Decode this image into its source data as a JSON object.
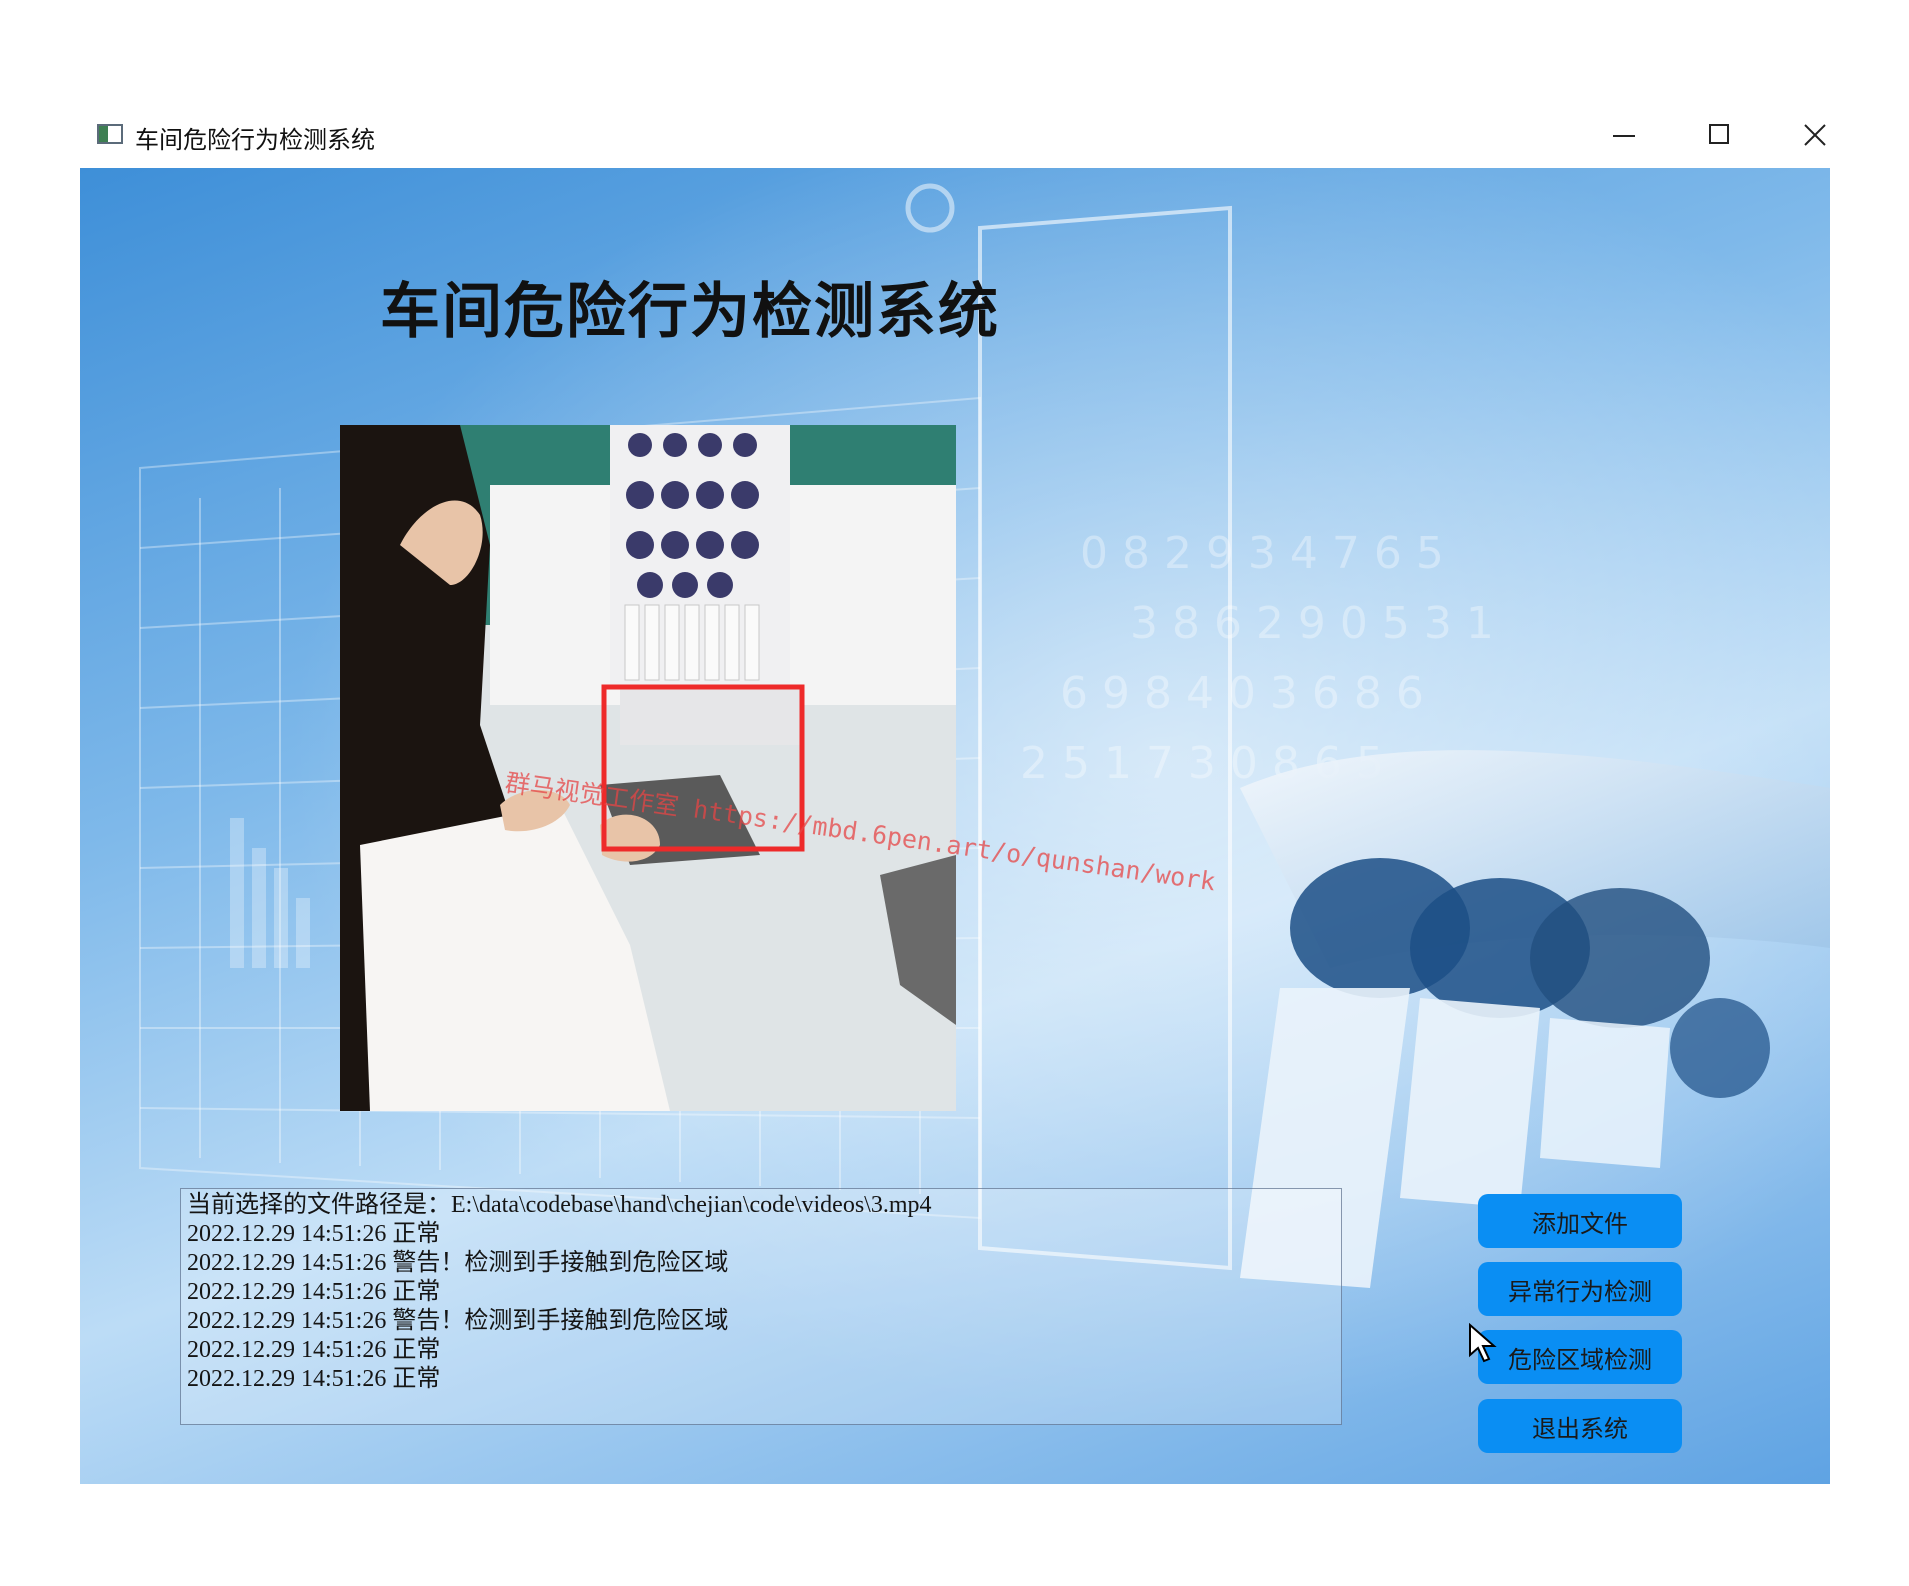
{
  "window": {
    "title": "车间危险行为检测系统",
    "icon": "app-window-icon",
    "controls": [
      "minimize-icon",
      "maximize-icon",
      "close-icon"
    ]
  },
  "main": {
    "title": "车间危险行为检测系统",
    "watermark": "群马视觉工作室 https://mbd.6pen.art/o/qunshan/work"
  },
  "log": {
    "lines": [
      "当前选择的文件路径是：E:\\data\\codebase\\hand\\chejian\\code\\videos\\3.mp4",
      "2022.12.29 14:51:26 正常",
      "2022.12.29 14:51:26 警告！检测到手接触到危险区域",
      "2022.12.29 14:51:26 正常",
      "2022.12.29 14:51:26 警告！检测到手接触到危险区域",
      "2022.12.29 14:51:26 正常",
      "2022.12.29 14:51:26 正常"
    ]
  },
  "buttons": {
    "add_file": "添加文件",
    "abnormal_detect": "异常行为检测",
    "danger_zone_detect": "危险区域检测",
    "exit": "退出系统"
  },
  "colors": {
    "button_bg": "#0a8ef3",
    "detection_box": "#ee2a2a",
    "background_accent": "#5fa3e3"
  }
}
